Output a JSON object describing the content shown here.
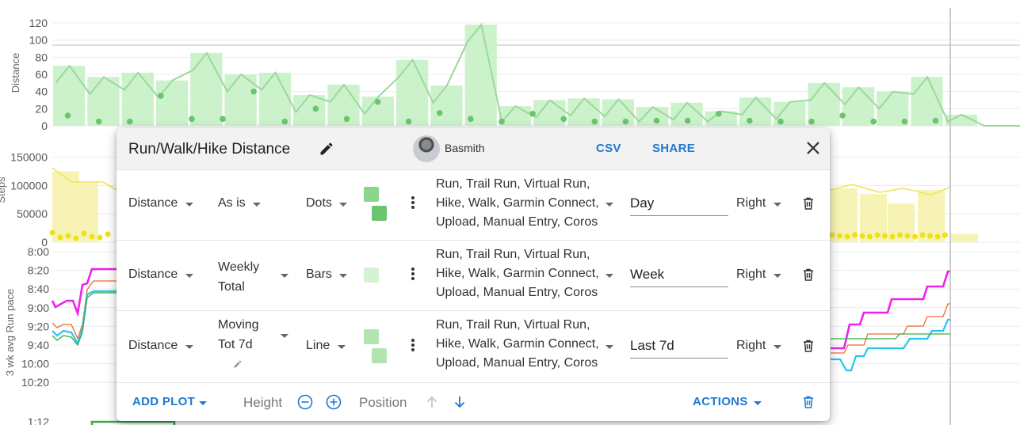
{
  "background_charts": [
    {
      "axis_label": "Distance",
      "ticks": [
        "120",
        "100",
        "80",
        "60",
        "40",
        "20",
        "0"
      ],
      "colors": {
        "bar": "#ccf2cc",
        "line": "#9bd99b",
        "dot": "#6cc46c"
      },
      "weekly_bars": [
        70,
        57,
        62,
        53,
        85,
        60,
        62,
        36,
        48,
        34,
        77,
        47,
        118,
        23,
        30,
        32,
        31,
        22,
        27,
        17,
        33,
        28,
        50,
        45,
        40,
        57,
        13
      ],
      "daily_dots": [
        12,
        5,
        5,
        35,
        8,
        8,
        40,
        5,
        20,
        8,
        28,
        5,
        15,
        8,
        5,
        14,
        8,
        5,
        5,
        6,
        6,
        14,
        6,
        5,
        5,
        12,
        5,
        5,
        6
      ]
    },
    {
      "axis_label": "Steps",
      "ticks": [
        "150000",
        "100000",
        "50000",
        "0"
      ],
      "colors": {
        "bar": "#f6f3b5",
        "line": "#f2e45c",
        "dot": "#eee11a"
      }
    },
    {
      "axis_label": "3 wk avg Run pace",
      "ticks": [
        "8:00",
        "8:20",
        "8:40",
        "9:00",
        "9:20",
        "9:40",
        "10:00",
        "10:20"
      ],
      "partial_tick": "1:12",
      "colors": {
        "magenta": "#ee22ee",
        "orange": "#f06a30",
        "cyan": "#22c8ee",
        "green": "#3aaa4a"
      }
    }
  ],
  "dialog": {
    "title": "Run/Walk/Hike Distance",
    "user": "Basmith",
    "csv_label": "CSV",
    "share_label": "SHARE",
    "rows": [
      {
        "metric": "Distance",
        "transform": "As is",
        "style": "Dots",
        "swatch_color": "#8cd68c",
        "activities": "Run, Trail Run, Virtual Run, Hike, Walk, Garmin Connect, Upload, Manual Entry, Coros",
        "period": "Day",
        "axis_side": "Right"
      },
      {
        "metric": "Distance",
        "transform": "Weekly Total",
        "style": "Bars",
        "swatch_color": "#d5f2d5",
        "activities": "Run, Trail Run, Virtual Run, Hike, Walk, Garmin Connect, Upload, Manual Entry, Coros",
        "period": "Week",
        "axis_side": "Right"
      },
      {
        "metric": "Distance",
        "transform": "Moving Tot 7d",
        "style": "Line",
        "swatch_color": "#b2e4b2",
        "activities": "Run, Trail Run, Virtual Run, Hike, Walk, Garmin Connect, Upload, Manual Entry, Coros",
        "period": "Last 7d",
        "axis_side": "Right"
      }
    ],
    "footer": {
      "add_plot": "ADD PLOT",
      "height_label": "Height",
      "position_label": "Position",
      "actions_label": "ACTIONS"
    }
  }
}
